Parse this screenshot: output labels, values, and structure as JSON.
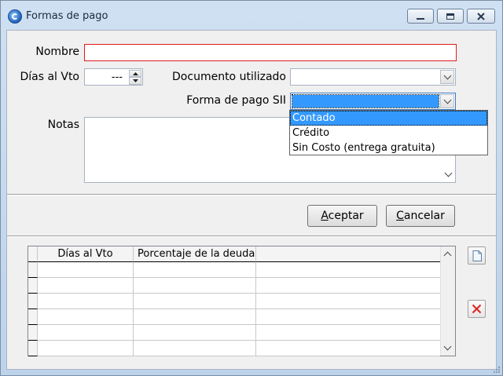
{
  "window": {
    "title": "Formas de pago",
    "icon": "app-logo-icon"
  },
  "form": {
    "nombre_label": "Nombre",
    "nombre_value": "",
    "dias_label": "Días al Vto",
    "dias_value": "---",
    "documento_label": "Documento utilizado",
    "documento_value": "",
    "forma_pago_label": "Forma de pago SII",
    "forma_pago_value": "",
    "notas_label": "Notas",
    "notas_value": ""
  },
  "dropdown": {
    "options": [
      "Contado",
      "Crédito",
      "Sin Costo (entrega gratuita)"
    ],
    "highlighted": "Contado"
  },
  "buttons": {
    "accept": {
      "pre": "",
      "accel": "A",
      "post": "ceptar"
    },
    "cancel": {
      "pre": "",
      "accel": "C",
      "post": "ancelar"
    }
  },
  "table": {
    "columns": [
      "Días al Vto",
      "Porcentaje de la deuda"
    ],
    "row_count": 6
  },
  "colors": {
    "required_border": "#e11a1a",
    "selection": "#3399ff",
    "delete_icon": "#e02020"
  }
}
